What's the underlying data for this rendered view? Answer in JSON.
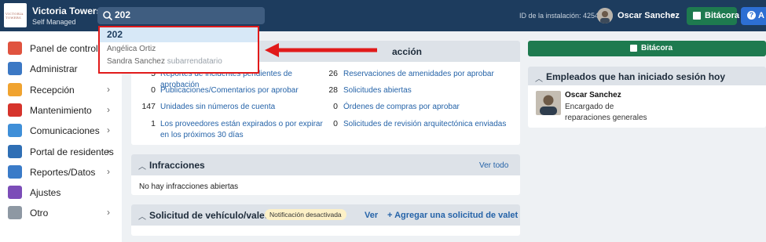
{
  "header": {
    "logo_text": "VICTORIA TOWERS",
    "property_name": "Victoria Towers",
    "property_sub": "Self Managed",
    "search_value": "202",
    "install_id": "ID de la instalación: 4254",
    "user_name": "Oscar Sanchez",
    "bitacora_label": "Bitácora",
    "help_label": "A"
  },
  "search_dropdown": {
    "title": "202",
    "row1": "Angélica Ortiz",
    "row2_name": "Sandra Sanchez",
    "row2_role": "subarrendatario"
  },
  "sidebar": {
    "items": [
      {
        "label": "Panel de control",
        "icon": "home-icon",
        "color": "#e0533f",
        "chevron": ""
      },
      {
        "label": "Administrar",
        "icon": "building-icon",
        "color": "#3b78c4",
        "chevron": "›"
      },
      {
        "label": "Recepción",
        "icon": "bell-icon",
        "color": "#f0a330",
        "chevron": "›"
      },
      {
        "label": "Mantenimiento",
        "icon": "toolbox-icon",
        "color": "#d6342c",
        "chevron": "›"
      },
      {
        "label": "Comunicaciones",
        "icon": "mail-icon",
        "color": "#3f8fd8",
        "chevron": "›"
      },
      {
        "label": "Portal de residentes",
        "icon": "portal-icon",
        "color": "#2f6fb5",
        "chevron": "›"
      },
      {
        "label": "Reportes/Datos",
        "icon": "chart-icon",
        "color": "#3a7bc8",
        "chevron": "›"
      },
      {
        "label": "Ajustes",
        "icon": "gear-icon",
        "color": "#7c4db8",
        "chevron": ""
      },
      {
        "label": "Otro",
        "icon": "more-icon",
        "color": "#8e98a3",
        "chevron": "›"
      }
    ]
  },
  "action_panel": {
    "title_fragment": "acción",
    "left": [
      {
        "num": "5",
        "label": "Reportes de incidentes pendientes de aprobación"
      },
      {
        "num": "0",
        "label": "Publicaciones/Comentarios por aprobar"
      },
      {
        "num": "147",
        "label": "Unidades sin números de cuenta"
      },
      {
        "num": "1",
        "label": "Los proveedores están expirados o por expirar en los próximos 30 días"
      }
    ],
    "right": [
      {
        "num": "26",
        "label": "Reservaciones de amenidades por aprobar"
      },
      {
        "num": "28",
        "label": "Solicitudes abiertas"
      },
      {
        "num": "0",
        "label": "Órdenes de compras por aprobar"
      },
      {
        "num": "0",
        "label": "Solicitudes de revisión arquitectónica enviadas"
      }
    ]
  },
  "infractions_panel": {
    "title": "Infracciones",
    "link": "Ver todo",
    "empty_text": "No hay infracciones abiertas"
  },
  "valet_panel": {
    "title": "Solicitud de vehículo/valet",
    "badge": "Notificación desactivada",
    "link_view": "Ver",
    "link_add": "+ Agregar una solicitud de valet"
  },
  "right_col": {
    "bitacora_label": "Bitácora",
    "employees_title": "Empleados que han iniciado sesión hoy",
    "employee_name": "Oscar Sanchez",
    "employee_role_1": "Encargado de",
    "employee_role_2": "reparaciones generales"
  },
  "colors": {
    "topbar": "#1d3c5e",
    "accent_green": "#1e7a4f",
    "link_blue": "#2563a8",
    "highlight_red": "#e11a1a"
  }
}
